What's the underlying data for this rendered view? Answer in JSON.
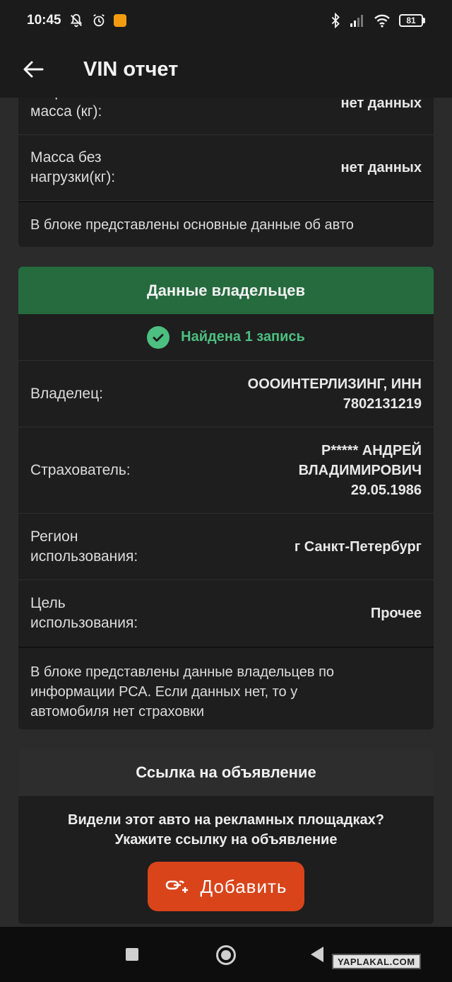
{
  "status_bar": {
    "time": "10:45",
    "battery": "81"
  },
  "app_bar": {
    "title": "VIN отчет"
  },
  "vehicle_card": {
    "rows": [
      {
        "label": "Разрешенная max. масса (кг):",
        "value": "нет данных"
      },
      {
        "label": "Масса без нагрузки(кг):",
        "value": "нет данных"
      }
    ],
    "note": "В блоке представлены основные данные об авто"
  },
  "owners_card": {
    "title": "Данные владельцев",
    "found_text": "Найдена 1 запись",
    "rows": [
      {
        "label": "Владелец:",
        "value": "ОООИНТЕРЛИЗИНГ, ИНН 7802131219"
      },
      {
        "label": "Страхователь:",
        "value": "Р***** АНДРЕЙ ВЛАДИМИРОВИЧ 29.05.1986"
      },
      {
        "label": "Регион использования:",
        "value": "г Санкт-Петербург"
      },
      {
        "label": "Цель использования:",
        "value": "Прочее"
      }
    ],
    "note": "В блоке представлены данные владельцев по информации РСА. Если данных нет, то у автомобиля нет страховки"
  },
  "ad_card": {
    "title": "Ссылка на объявление",
    "question_line1": "Видели этот авто на рекламных площадках?",
    "question_line2": "Укажите ссылку на объявление",
    "add_label": "Добавить"
  },
  "watermark": "YAPLAKAL.COM"
}
